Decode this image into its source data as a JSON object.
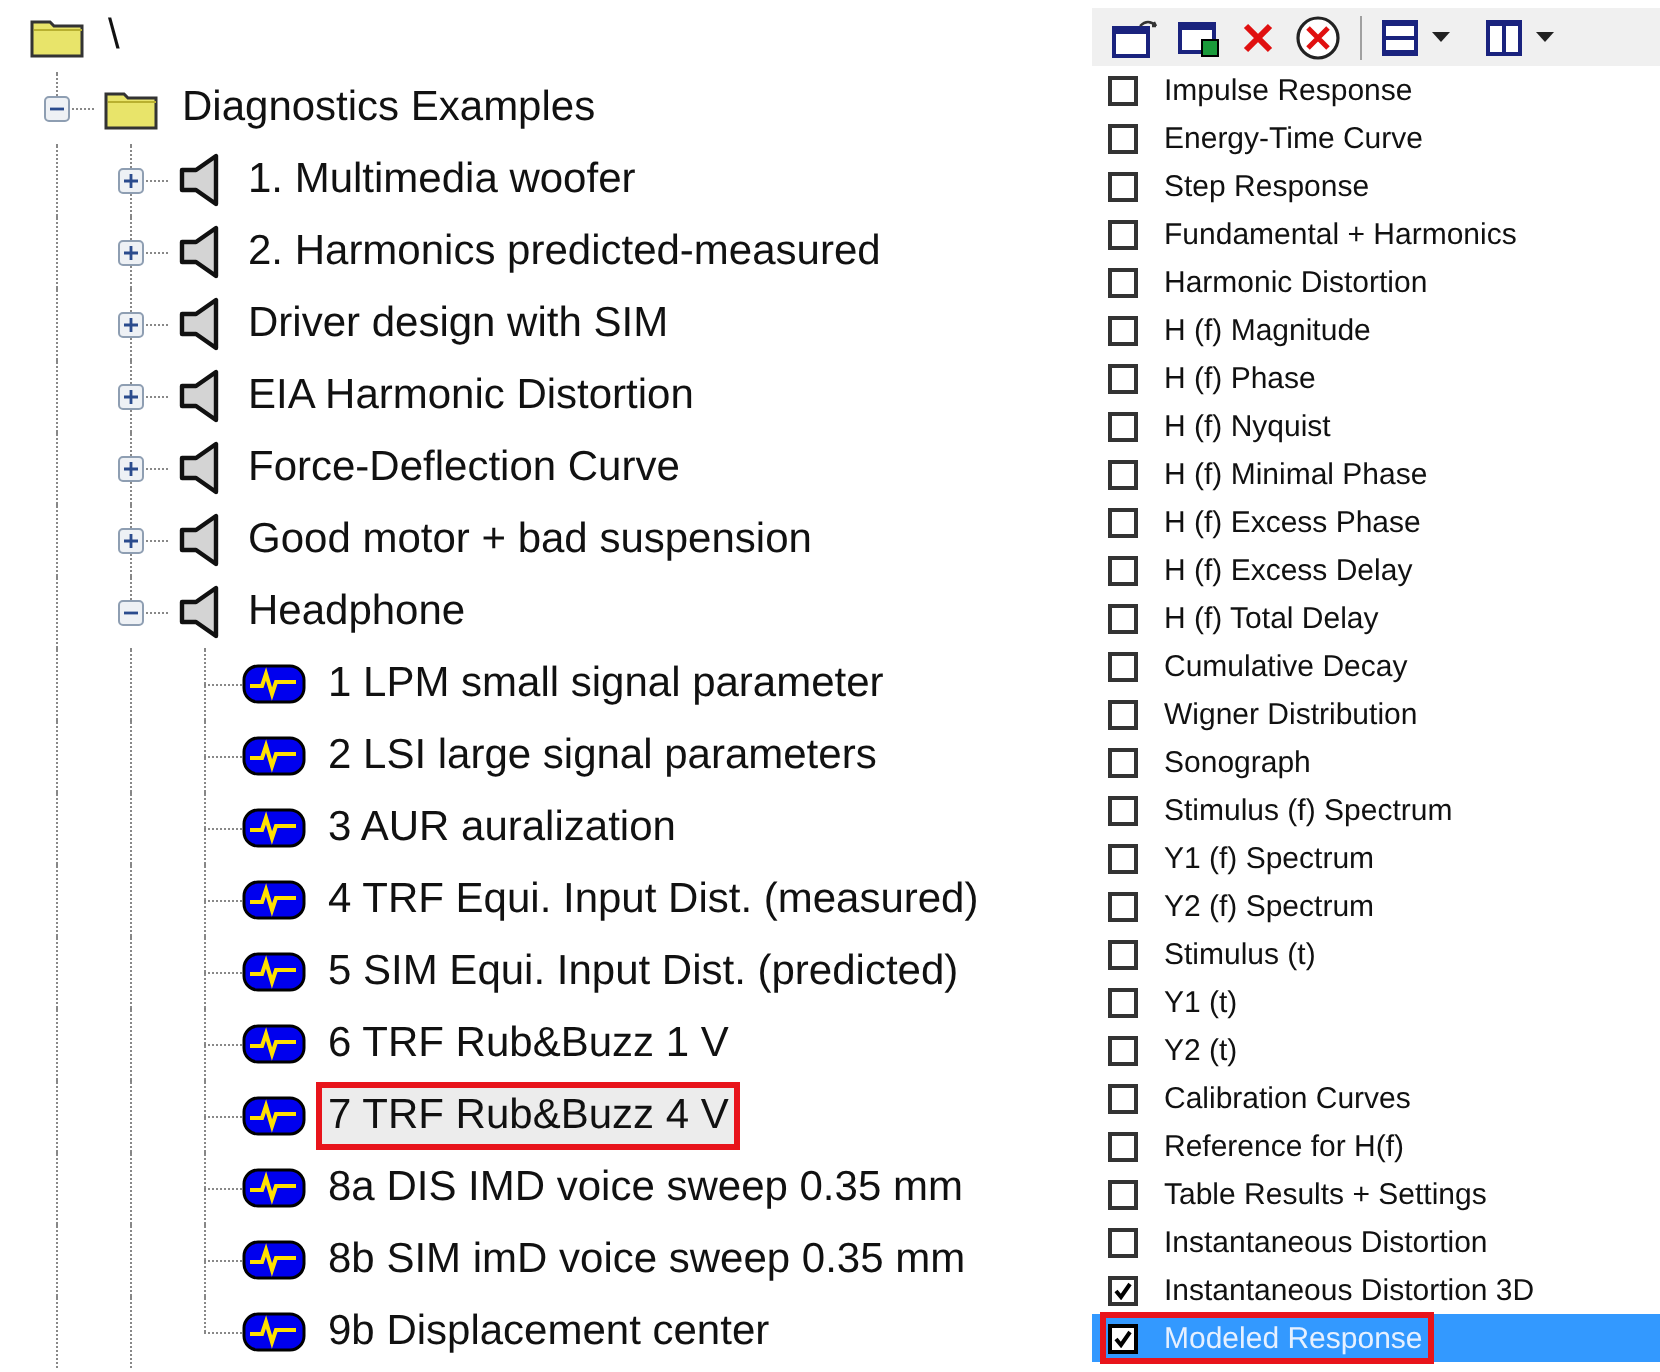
{
  "tree": {
    "label": "\\",
    "kind": "folder",
    "children": [
      {
        "label": "Diagnostics Examples",
        "kind": "folder",
        "expanded": true,
        "children": [
          {
            "label": "1. Multimedia woofer",
            "kind": "speaker",
            "expanded": false
          },
          {
            "label": "2. Harmonics predicted-measured",
            "kind": "speaker",
            "expanded": false
          },
          {
            "label": "Driver design with SIM",
            "kind": "speaker",
            "expanded": false
          },
          {
            "label": "EIA Harmonic Distortion",
            "kind": "speaker",
            "expanded": false
          },
          {
            "label": "Force-Deflection Curve",
            "kind": "speaker",
            "expanded": false
          },
          {
            "label": "Good motor + bad suspension",
            "kind": "speaker",
            "expanded": false
          },
          {
            "label": "Headphone",
            "kind": "speaker",
            "expanded": true,
            "children": [
              {
                "label": "1 LPM small signal parameter",
                "kind": "measurement",
                "selected": false
              },
              {
                "label": "2 LSI large signal parameters",
                "kind": "measurement",
                "selected": false
              },
              {
                "label": "3 AUR auralization",
                "kind": "measurement",
                "selected": false
              },
              {
                "label": "4 TRF Equi. Input Dist. (measured)",
                "kind": "measurement",
                "selected": false
              },
              {
                "label": "5 SIM Equi. Input Dist. (predicted)",
                "kind": "measurement",
                "selected": false
              },
              {
                "label": "6 TRF Rub&Buzz 1 V",
                "kind": "measurement",
                "selected": false
              },
              {
                "label": "7 TRF Rub&Buzz 4 V",
                "kind": "measurement",
                "selected": true
              },
              {
                "label": "8a DIS IMD voice sweep 0.35 mm",
                "kind": "measurement",
                "selected": false
              },
              {
                "label": "8b SIM imD voice sweep 0.35 mm",
                "kind": "measurement",
                "selected": false
              },
              {
                "label": "9b Displacement center",
                "kind": "measurement",
                "selected": false
              }
            ]
          }
        ]
      }
    ]
  },
  "results": [
    {
      "label": "Impulse Response",
      "checked": false,
      "selected": false
    },
    {
      "label": "Energy-Time Curve",
      "checked": false,
      "selected": false
    },
    {
      "label": "Step Response",
      "checked": false,
      "selected": false
    },
    {
      "label": "Fundamental + Harmonics",
      "checked": false,
      "selected": false
    },
    {
      "label": "Harmonic Distortion",
      "checked": false,
      "selected": false
    },
    {
      "label": "H (f)  Magnitude",
      "checked": false,
      "selected": false
    },
    {
      "label": "H (f)  Phase",
      "checked": false,
      "selected": false
    },
    {
      "label": "H (f)  Nyquist",
      "checked": false,
      "selected": false
    },
    {
      "label": "H (f) Minimal Phase",
      "checked": false,
      "selected": false
    },
    {
      "label": "H (f) Excess Phase",
      "checked": false,
      "selected": false
    },
    {
      "label": "H (f) Excess Delay",
      "checked": false,
      "selected": false
    },
    {
      "label": "H (f) Total Delay",
      "checked": false,
      "selected": false
    },
    {
      "label": "Cumulative Decay",
      "checked": false,
      "selected": false
    },
    {
      "label": "Wigner Distribution",
      "checked": false,
      "selected": false
    },
    {
      "label": "Sonograph",
      "checked": false,
      "selected": false
    },
    {
      "label": "Stimulus (f) Spectrum",
      "checked": false,
      "selected": false
    },
    {
      "label": "Y1 (f) Spectrum",
      "checked": false,
      "selected": false
    },
    {
      "label": "Y2 (f) Spectrum",
      "checked": false,
      "selected": false
    },
    {
      "label": "Stimulus (t)",
      "checked": false,
      "selected": false
    },
    {
      "label": "Y1 (t)",
      "checked": false,
      "selected": false
    },
    {
      "label": "Y2 (t)",
      "checked": false,
      "selected": false
    },
    {
      "label": "Calibration Curves",
      "checked": false,
      "selected": false
    },
    {
      "label": "Reference for H(f)",
      "checked": false,
      "selected": false
    },
    {
      "label": "Table Results + Settings",
      "checked": false,
      "selected": false
    },
    {
      "label": "Instantaneous Distortion",
      "checked": false,
      "selected": false
    },
    {
      "label": "Instantaneous Distortion 3D",
      "checked": true,
      "selected": false
    },
    {
      "label": "Modeled Response",
      "checked": true,
      "selected": true
    }
  ]
}
